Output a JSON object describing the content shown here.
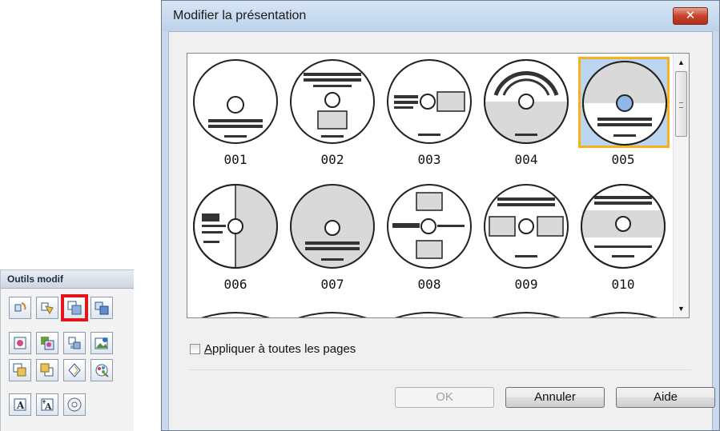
{
  "palette": {
    "title": "Outils modif",
    "rows": [
      [
        "rotate-tool-icon",
        "flip-tool-icon",
        "change-layout-icon",
        "layout-front-icon"
      ],
      [
        "image-icon",
        "background-icon",
        "arrange-icon",
        "insert-image-icon"
      ],
      [
        "move-front-icon",
        "move-back-icon",
        "shape-icon",
        "color-icon"
      ],
      [
        "text-icon",
        "vertical-text-icon",
        "disc-icon"
      ]
    ],
    "selected_tool": "change-layout-icon"
  },
  "dialog": {
    "title": "Modifier la présentation",
    "close_label": "✕",
    "layouts": [
      {
        "id": "001",
        "label": "001"
      },
      {
        "id": "002",
        "label": "002"
      },
      {
        "id": "003",
        "label": "003"
      },
      {
        "id": "004",
        "label": "004"
      },
      {
        "id": "005",
        "label": "005",
        "selected": true
      },
      {
        "id": "006",
        "label": "006"
      },
      {
        "id": "007",
        "label": "007"
      },
      {
        "id": "008",
        "label": "008"
      },
      {
        "id": "009",
        "label": "009"
      },
      {
        "id": "010",
        "label": "010"
      }
    ],
    "checkbox_label": "Appliquer à toutes les pages",
    "checkbox_checked": false,
    "buttons": {
      "ok": "OK",
      "cancel": "Annuler",
      "help": "Aide"
    }
  },
  "colors": {
    "selection_border": "#f5b21e",
    "selection_fill": "#bcd5f1",
    "tool_highlight": "#e3141a"
  }
}
